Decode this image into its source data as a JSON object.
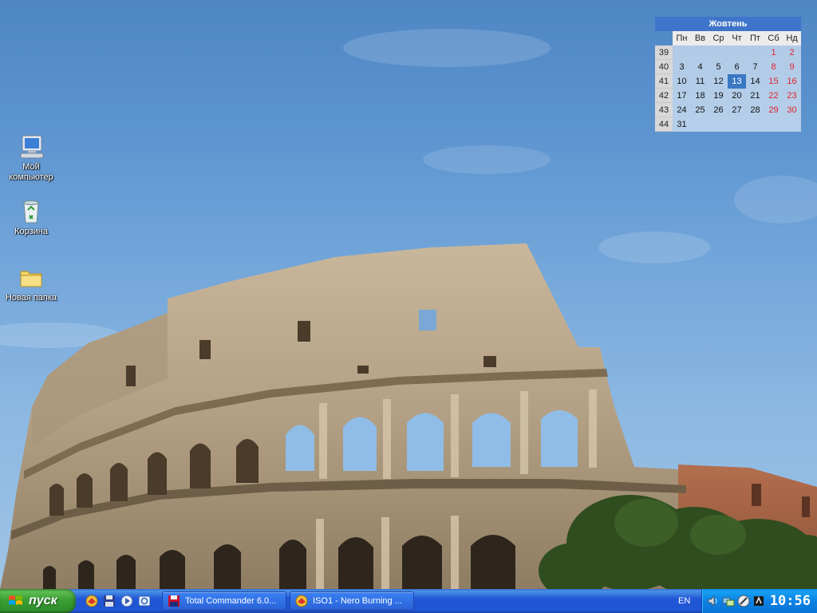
{
  "desktop": {
    "icons": [
      {
        "name": "my-computer",
        "label": "Мой компьютер"
      },
      {
        "name": "recycle-bin",
        "label": "Корзина"
      },
      {
        "name": "new-folder",
        "label": "Новая папка"
      }
    ]
  },
  "calendar": {
    "month": "Жовтень",
    "weekdays": [
      "Пн",
      "Вв",
      "Ср",
      "Чт",
      "Пт",
      "Сб",
      "Нд"
    ],
    "weeks": [
      {
        "num": "39",
        "days": [
          "",
          "",
          "",
          "",
          "",
          "1",
          "2"
        ]
      },
      {
        "num": "40",
        "days": [
          "3",
          "4",
          "5",
          "6",
          "7",
          "8",
          "9"
        ]
      },
      {
        "num": "41",
        "days": [
          "10",
          "11",
          "12",
          "13",
          "14",
          "15",
          "16"
        ]
      },
      {
        "num": "42",
        "days": [
          "17",
          "18",
          "19",
          "20",
          "21",
          "22",
          "23"
        ]
      },
      {
        "num": "43",
        "days": [
          "24",
          "25",
          "26",
          "27",
          "28",
          "29",
          "30"
        ]
      },
      {
        "num": "44",
        "days": [
          "31",
          "",
          "",
          "",
          "",
          "",
          ""
        ]
      }
    ],
    "today": "13",
    "weekend_color": "#e0242e",
    "today_color": "#3b78c4"
  },
  "taskbar": {
    "start_label": "пуск",
    "quick_launch": [
      "nero-icon",
      "save-icon",
      "media-player-icon",
      "outlook-icon"
    ],
    "tasks": [
      {
        "icon": "total-commander-icon",
        "label": "Total Commander 6.0..."
      },
      {
        "icon": "nero-icon",
        "label": "ISO1 - Nero Burning ..."
      }
    ],
    "language": "EN",
    "tray_icons": [
      "speaker-icon",
      "network-icon",
      "daemon-tools-icon",
      "antivirus-icon"
    ],
    "clock": "10:56"
  }
}
